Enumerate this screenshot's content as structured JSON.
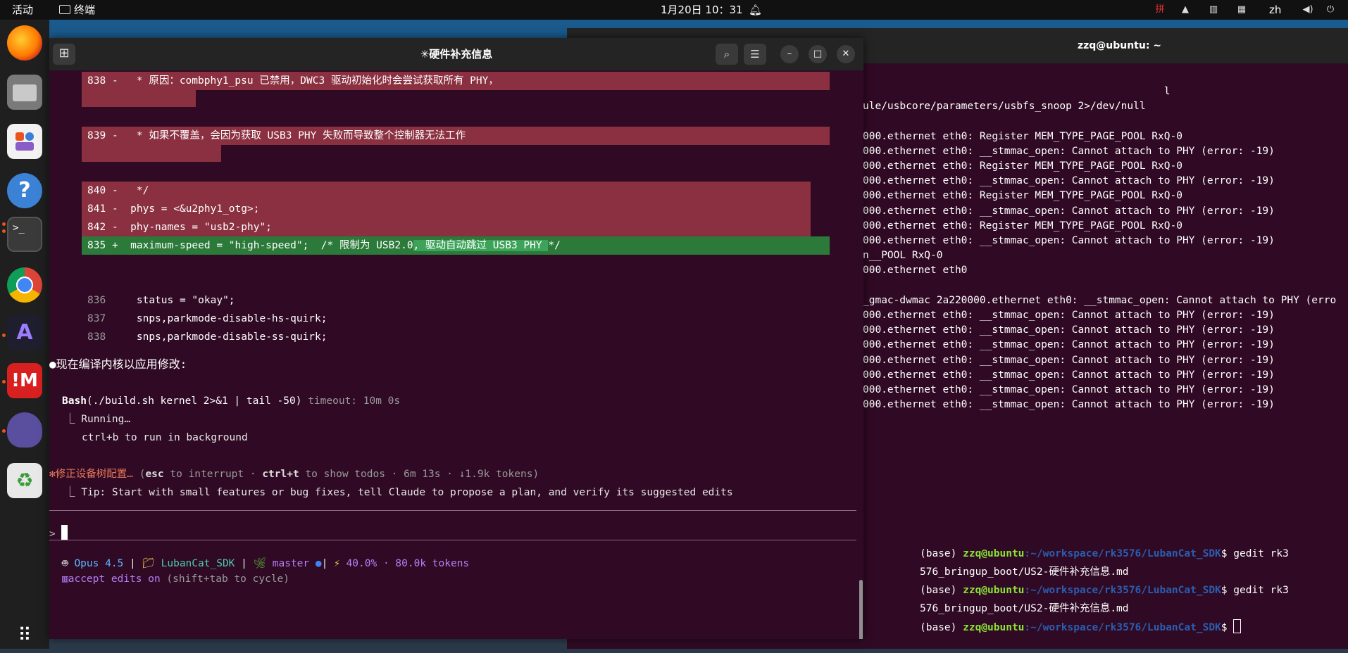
{
  "topbar": {
    "activities": "活动",
    "app_name": "终端",
    "clock": "1月20日 10：31",
    "input_method": "zh"
  },
  "dock": {
    "apps": [
      "Firefox",
      "Files",
      "App Center",
      "Help",
      "Terminal",
      "Chrome",
      "Cursor",
      "IM",
      "Cat",
      "Trash"
    ]
  },
  "term2": {
    "title": "zzq@ubuntu: ~",
    "lines": [
      "                                                 l",
      "ule/usbcore/parameters/usbfs_snoop 2>/dev/null",
      "",
      "000.ethernet eth0: Register MEM_TYPE_PAGE_POOL RxQ-0",
      "000.ethernet eth0: __stmmac_open: Cannot attach to PHY (error: -19)",
      "000.ethernet eth0: Register MEM_TYPE_PAGE_POOL RxQ-0",
      "000.ethernet eth0: __stmmac_open: Cannot attach to PHY (error: -19)",
      "000.ethernet eth0: Register MEM_TYPE_PAGE_POOL RxQ-0",
      "000.ethernet eth0: __stmmac_open: Cannot attach to PHY (error: -19)",
      "000.ethernet eth0: Register MEM_TYPE_PAGE_POOL RxQ-0",
      "000.ethernet eth0: __stmmac_open: Cannot attach to PHY (error: -19)",
      "n__POOL RxQ-0",
      "000.ethernet eth0",
      "",
      "_gmac-dwmac 2a220000.ethernet eth0: __stmmac_open: Cannot attach to PHY (erro",
      "000.ethernet eth0: __stmmac_open: Cannot attach to PHY (error: -19)",
      "000.ethernet eth0: __stmmac_open: Cannot attach to PHY (error: -19)",
      "000.ethernet eth0: __stmmac_open: Cannot attach to PHY (error: -19)",
      "000.ethernet eth0: __stmmac_open: Cannot attach to PHY (error: -19)",
      "000.ethernet eth0: __stmmac_open: Cannot attach to PHY (error: -19)",
      "000.ethernet eth0: __stmmac_open: Cannot attach to PHY (error: -19)",
      "000.ethernet eth0: __stmmac_open: Cannot attach to PHY (error: -19)"
    ]
  },
  "term3": {
    "base": "(base) ",
    "user": "zzq@ubuntu",
    "path": ":~/workspace/rk3576/LubanCat_SDK",
    "cmd1a": "$ gedit rk3",
    "cmd1b": "576_bringup_boot/US2-硬件补充信息.md",
    "cmd2a": "$ gedit rk3",
    "cmd2b": "576_bringup_boot/US2-硬件补充信息.md",
    "prompt_end": "$ "
  },
  "term1": {
    "title": "✳硬件补充信息",
    "diff": [
      {
        "num": "838",
        "sign": "-",
        "text": "   * 原因：combphy1_psu 已禁用，DWC3 驱动初始化时会尝试获取所有 PHY，"
      },
      {
        "num": "839",
        "sign": "-",
        "text": "   * 如果不覆盖，会因为获取 USB3 PHY 失败而导致整个控制器无法工作"
      },
      {
        "num": "840",
        "sign": "-",
        "text": "   */"
      },
      {
        "num": "841",
        "sign": "-",
        "text": "  phys = <&u2phy1_otg>;"
      },
      {
        "num": "842",
        "sign": "-",
        "text": "  phy-names = \"usb2-phy\";"
      },
      {
        "num": "835",
        "sign": "+",
        "text_a": "  maximum-speed = \"high-speed\";  /* 限制为 USB2.0",
        "text_b": ", 驱动自动跳过 ",
        "text_c": "USB3 PHY ",
        "text_d": "*/"
      }
    ],
    "context": [
      {
        "num": "836",
        "text": "  status = \"okay\";"
      },
      {
        "num": "837",
        "text": "  snps,parkmode-disable-hs-quirk;"
      },
      {
        "num": "838",
        "text": "  snps,parkmode-disable-ss-quirk;"
      }
    ],
    "message": "现在编译内核以应用修改:",
    "bash_label": "Bash",
    "bash_cmd": "(./build.sh kernel 2>&1 | tail -50)",
    "bash_timeout": " timeout: 10m 0s",
    "running": "Running…",
    "background_hint": "ctrl+b to run in background",
    "status_title": "修正设备树配置…",
    "status_a": " (",
    "status_esc": "esc",
    "status_b": " to interrupt · ",
    "status_ctrlt": "ctrl+t",
    "status_c": " to show todos · 6m 13s · ↓1.9k tokens)",
    "tip": "Tip: Start with small features or bug fixes, tell Claude to propose a plan, and verify its suggested edits",
    "prompt_symbol": ">",
    "model": "Opus 4.5",
    "project": "LubanCat_SDK",
    "branch": "master",
    "usage": "40.0% · 80.0k tokens",
    "mode": "accept edits on",
    "mode_hint": " (shift+tab to cycle)"
  }
}
